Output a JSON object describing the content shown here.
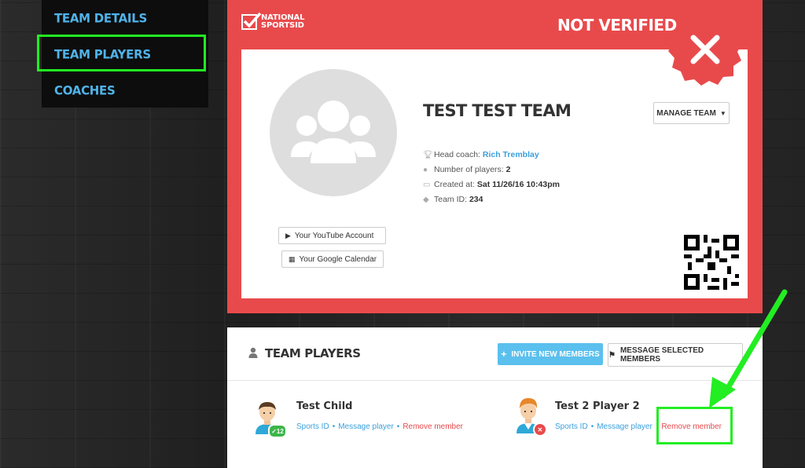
{
  "sidebar": {
    "items": [
      {
        "label": "TEAM DETAILS"
      },
      {
        "label": "TEAM PLAYERS"
      },
      {
        "label": "COACHES"
      }
    ]
  },
  "card": {
    "logo_line1": "NATIONAL",
    "logo_line2": "SPORTSID",
    "status": "NOT VERIFIED",
    "team_name": "TEST TEST TEAM",
    "manage_label": "MANAGE TEAM",
    "youtube_label": "Your YouTube Account",
    "calendar_label": "Your Google Calendar",
    "head_coach_label": "Head coach:",
    "head_coach_value": "Rich Tremblay",
    "players_label": "Number of players:",
    "players_value": "2",
    "created_label": "Created at:",
    "created_value": "Sat 11/26/16 10:43pm",
    "team_id_label": "Team ID:",
    "team_id_value": "234"
  },
  "players_section": {
    "title": "TEAM PLAYERS",
    "invite_label": "INVITE NEW MEMBERS",
    "message_label": "MESSAGE SELECTED MEMBERS",
    "players": [
      {
        "name": "Test Child",
        "badge": "12",
        "status": "verified",
        "sports_id": "Sports ID",
        "message": "Message player",
        "remove": "Remove member"
      },
      {
        "name": "Test 2 Player 2",
        "status": "not-verified",
        "sports_id": "Sports ID",
        "message": "Message player",
        "remove": "Remove member"
      }
    ]
  },
  "colors": {
    "accent_red": "#e84a4c",
    "link_blue": "#3aa0dd",
    "invite_blue": "#5bc0ee",
    "highlight_green": "#22ee22"
  }
}
